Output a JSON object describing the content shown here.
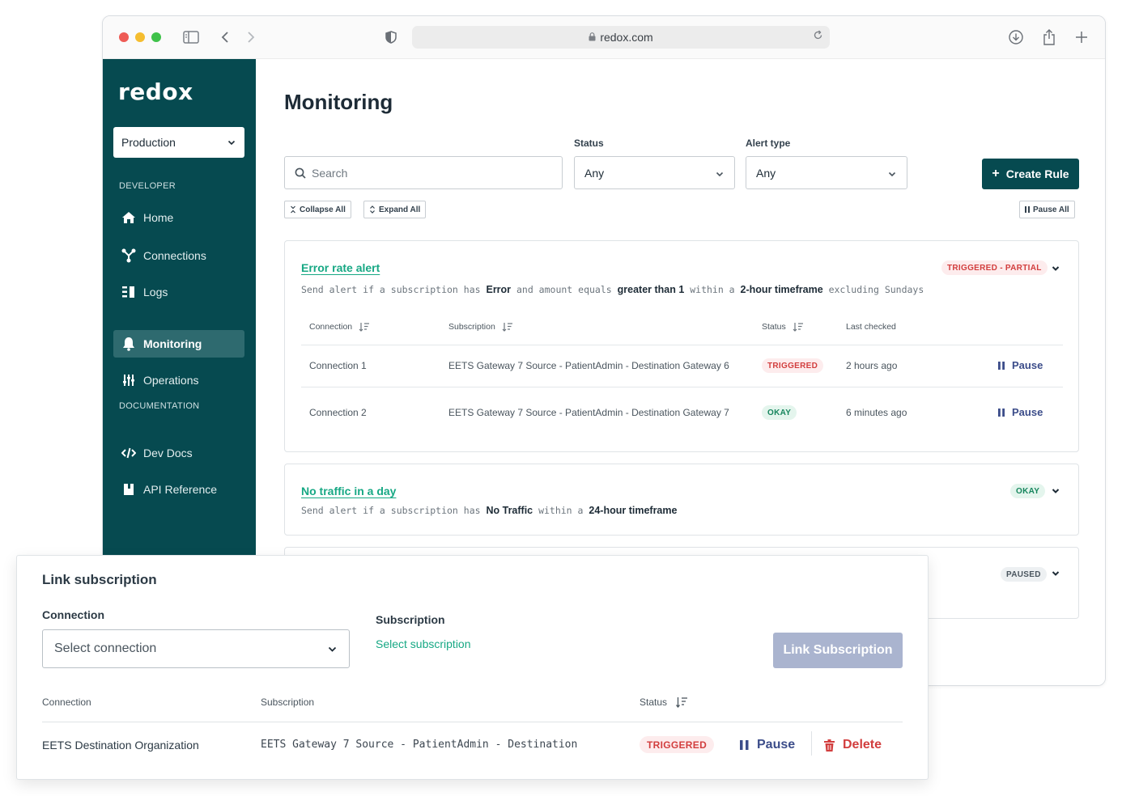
{
  "browser": {
    "url": "redox.com",
    "icons": [
      "sidebar-toggle-icon",
      "back-icon",
      "forward-icon",
      "shield-icon",
      "lock-icon",
      "reload-icon",
      "download-icon",
      "share-icon",
      "new-tab-icon"
    ]
  },
  "sidebar": {
    "logo": "redox",
    "environment": "Production",
    "developer_label": "DEVELOPER",
    "documentation_label": "DOCUMENTATION",
    "items": [
      {
        "label": "Home",
        "icon": "home-icon"
      },
      {
        "label": "Connections",
        "icon": "connections-icon"
      },
      {
        "label": "Logs",
        "icon": "logs-icon"
      },
      {
        "label": "Monitoring",
        "icon": "bell-icon",
        "active": true
      },
      {
        "label": "Operations",
        "icon": "sliders-icon"
      },
      {
        "label": "Dev Docs",
        "icon": "code-icon"
      },
      {
        "label": "API Reference",
        "icon": "book-icon"
      }
    ]
  },
  "main": {
    "title": "Monitoring",
    "search_placeholder": "Search",
    "status_label": "Status",
    "status_value": "Any",
    "alert_type_label": "Alert type",
    "alert_type_value": "Any",
    "create_rule": "Create Rule",
    "collapse_all": "Collapse All",
    "expand_all": "Expand All",
    "pause_all": "Pause All"
  },
  "rules": [
    {
      "title": "Error rate alert",
      "status": "TRIGGERED - PARTIAL",
      "desc": {
        "p1": "Send alert if a subscription has ",
        "b1": "Error",
        "p2": " and amount equals ",
        "b2": "greater than 1",
        "p3": " within a ",
        "b3": "2-hour timeframe",
        "p4": " excluding Sundays"
      },
      "columns": {
        "connection": "Connection",
        "subscription": "Subscription",
        "status": "Status",
        "last_checked": "Last checked"
      },
      "rows": [
        {
          "connection": "Connection 1",
          "subscription": "EETS Gateway 7 Source - PatientAdmin - Destination Gateway 6",
          "status": "TRIGGERED",
          "last_checked": "2 hours ago",
          "action": "Pause"
        },
        {
          "connection": "Connection 2",
          "subscription": "EETS Gateway 7 Source - PatientAdmin - Destination Gateway 7",
          "status": "OKAY",
          "last_checked": "6 minutes ago",
          "action": "Pause"
        }
      ]
    },
    {
      "title": "No traffic in a day",
      "status": "OKAY",
      "desc": {
        "p1": "Send alert if a subscription has ",
        "b1": "No Traffic",
        "p2": " within a ",
        "b2": "24-hour timeframe"
      }
    },
    {
      "status": "PAUSED"
    }
  ],
  "panel": {
    "title": "Link subscription",
    "connection_label": "Connection",
    "connection_placeholder": "Select connection",
    "subscription_label": "Subscription",
    "subscription_link": "Select subscription",
    "link_button": "Link Subscription",
    "columns": {
      "connection": "Connection",
      "subscription": "Subscription",
      "status": "Status"
    },
    "row": {
      "connection": "EETS Destination Organization",
      "subscription": "EETS Gateway 7 Source - PatientAdmin - Destination",
      "status": "TRIGGERED",
      "pause": "Pause",
      "delete": "Delete"
    }
  },
  "colors": {
    "brand": "#064a50",
    "accent_green": "#17a884",
    "danger": "#d23e3e",
    "link_blue": "#3c4d8a"
  }
}
